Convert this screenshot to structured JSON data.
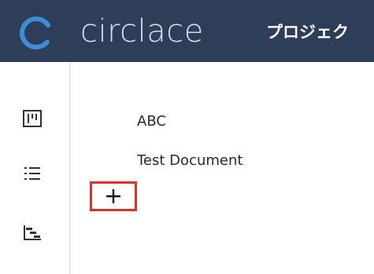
{
  "header": {
    "logo_text": "circlace",
    "nav_title": "プロジェク"
  },
  "sidebar": {
    "items": [
      {
        "icon": "board-icon"
      },
      {
        "icon": "list-icon"
      },
      {
        "icon": "gantt-icon"
      }
    ]
  },
  "content": {
    "items": [
      {
        "label": "ABC"
      },
      {
        "label": "Test Document"
      }
    ]
  },
  "add_button": {
    "icon": "plus-icon"
  },
  "colors": {
    "header_bg": "#2e3e58",
    "logo_accent": "#3b8fd6",
    "highlight": "#d9312b"
  }
}
